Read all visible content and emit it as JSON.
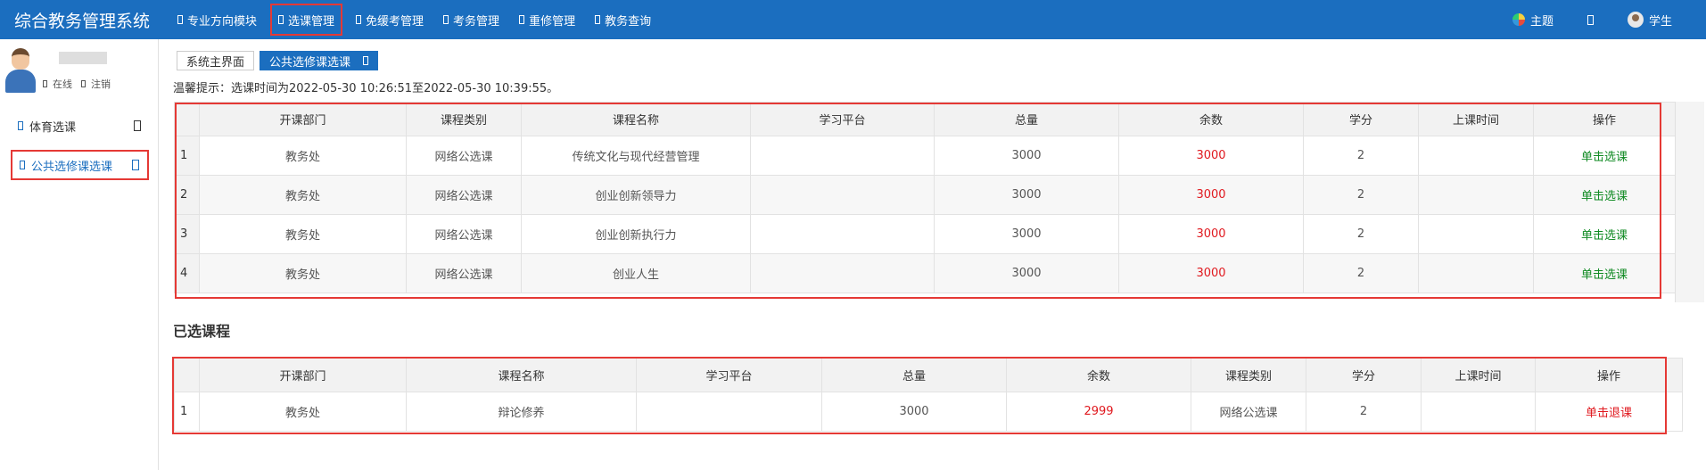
{
  "app": {
    "title": "综合教务管理系统"
  },
  "nav": {
    "items": [
      {
        "label": "专业方向模块"
      },
      {
        "label": "选课管理"
      },
      {
        "label": "免缓考管理"
      },
      {
        "label": "考务管理"
      },
      {
        "label": "重修管理"
      },
      {
        "label": "教务查询"
      }
    ],
    "active_index": 1,
    "theme_label": "主题",
    "user_label": "学生"
  },
  "sidebar": {
    "status_online": "在线",
    "status_logout": "注销",
    "items": [
      {
        "label": "体育选课"
      },
      {
        "label": "公共选修课选课"
      }
    ],
    "active_index": 1
  },
  "tabs": {
    "home": "系统主界面",
    "current": "公共选修课选课"
  },
  "tip": "温馨提示：选课时间为2022-05-30 10:26:51至2022-05-30 10:39:55。",
  "available": {
    "columns": [
      "开课部门",
      "课程类别",
      "课程名称",
      "学习平台",
      "总量",
      "余数",
      "学分",
      "上课时间",
      "操作"
    ],
    "rows": [
      {
        "idx": "1",
        "dept": "教务处",
        "category": "网络公选课",
        "name": "传统文化与现代经营管理",
        "platform": "",
        "total": "3000",
        "remaining": "3000",
        "credit": "2",
        "time": "",
        "action": "单击选课"
      },
      {
        "idx": "2",
        "dept": "教务处",
        "category": "网络公选课",
        "name": "创业创新领导力",
        "platform": "",
        "total": "3000",
        "remaining": "3000",
        "credit": "2",
        "time": "",
        "action": "单击选课"
      },
      {
        "idx": "3",
        "dept": "教务处",
        "category": "网络公选课",
        "name": "创业创新执行力",
        "platform": "",
        "total": "3000",
        "remaining": "3000",
        "credit": "2",
        "time": "",
        "action": "单击选课"
      },
      {
        "idx": "4",
        "dept": "教务处",
        "category": "网络公选课",
        "name": "创业人生",
        "platform": "",
        "total": "3000",
        "remaining": "3000",
        "credit": "2",
        "time": "",
        "action": "单击选课"
      }
    ]
  },
  "selected": {
    "title": "已选课程",
    "columns": [
      "开课部门",
      "课程名称",
      "学习平台",
      "总量",
      "余数",
      "课程类别",
      "学分",
      "上课时间",
      "操作"
    ],
    "rows": [
      {
        "idx": "1",
        "dept": "教务处",
        "name": "辩论修养",
        "platform": "",
        "total": "3000",
        "remaining": "2999",
        "category": "网络公选课",
        "credit": "2",
        "time": "",
        "action": "单击退课"
      }
    ]
  },
  "colors": {
    "header_blue": "#1b6ebf",
    "highlight_red": "#e53935",
    "remaining_red": "#e0191f",
    "action_green": "#0f8a22"
  }
}
